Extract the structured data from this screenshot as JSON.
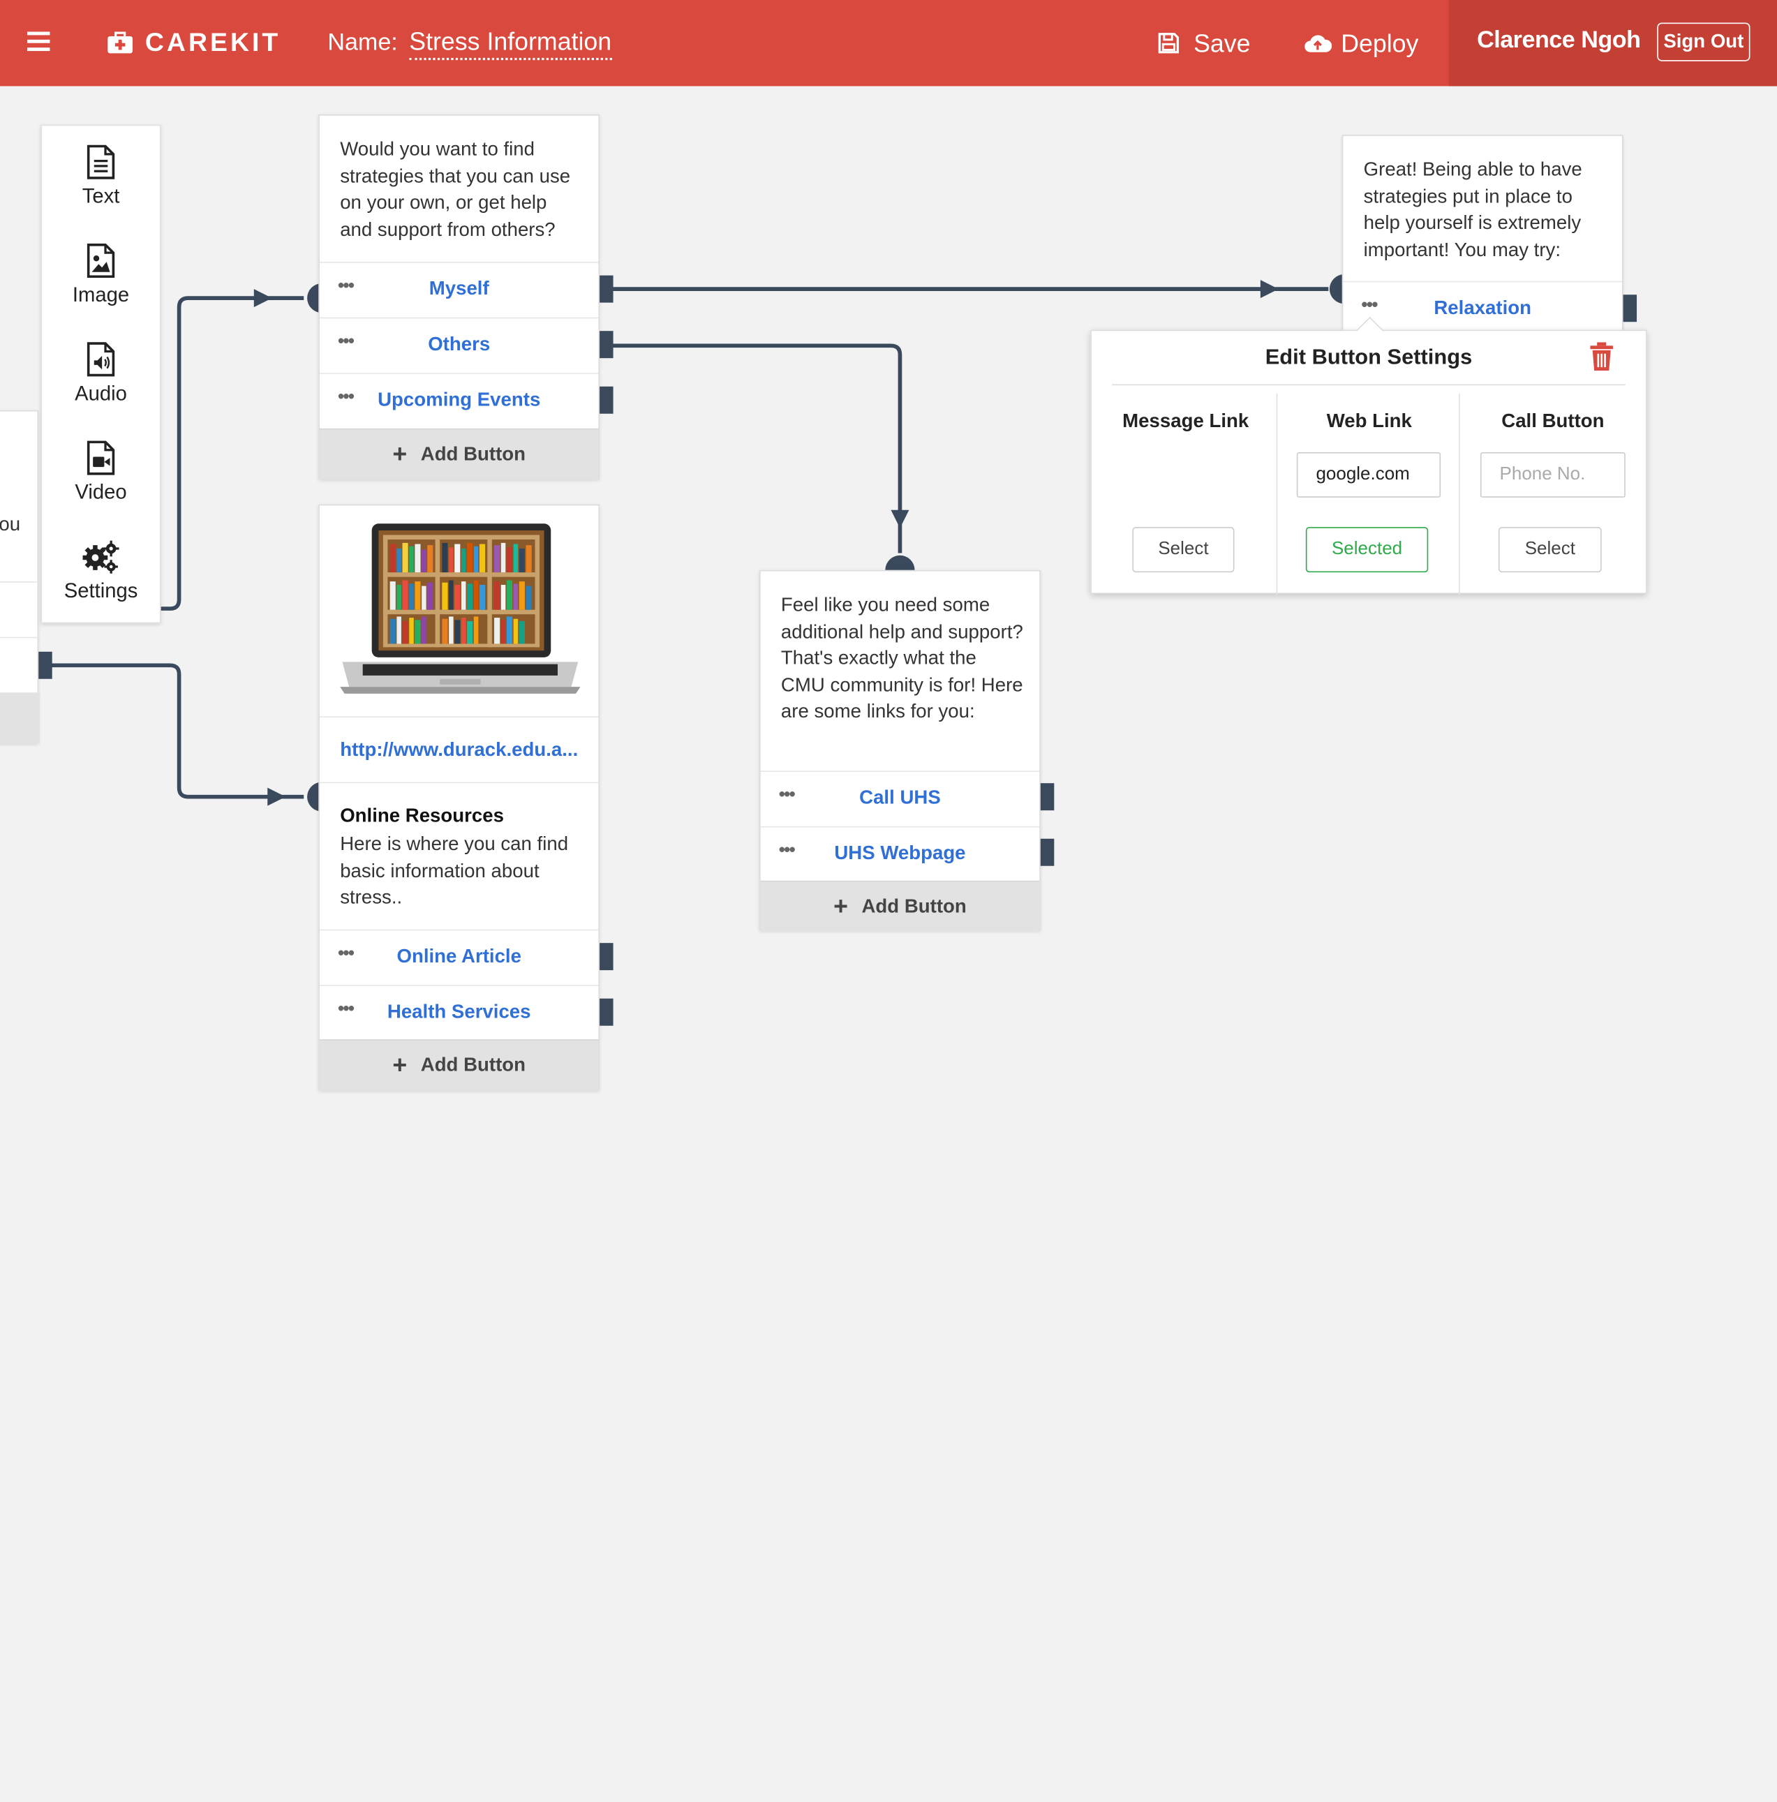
{
  "header": {
    "brand": "CAREKIT",
    "name_label": "Name:",
    "name_value": "Stress Information",
    "save_label": "Save",
    "deploy_label": "Deploy",
    "user_name": "Clarence Ngoh",
    "signout_label": "Sign Out"
  },
  "palette": [
    {
      "label": "Text",
      "icon": "text-doc-icon"
    },
    {
      "label": "Image",
      "icon": "image-doc-icon"
    },
    {
      "label": "Audio",
      "icon": "audio-doc-icon"
    },
    {
      "label": "Video",
      "icon": "video-doc-icon"
    },
    {
      "label": "Settings",
      "icon": "gears-icon"
    }
  ],
  "left_card": {
    "text": "ou"
  },
  "card_question": {
    "text": "Would you want to find strategies that you can use on your own, or get help and support from others?",
    "buttons": [
      "Myself",
      "Others",
      "Upcoming Events"
    ],
    "add_label": "Add Button"
  },
  "card_resources": {
    "link": "http://www.durack.edu.a...",
    "title": "Online Resources",
    "text": "Here is where you can find basic information about stress..",
    "buttons": [
      "Online Article",
      "Health Services"
    ],
    "add_label": "Add Button"
  },
  "card_support": {
    "text": "Feel like you need some additional help and support? That's exactly what the CMU community is for! Here are some links for you:",
    "buttons": [
      "Call UHS",
      "UHS Webpage"
    ],
    "add_label": "Add Button"
  },
  "card_great": {
    "text": "Great! Being able to have strategies put in place to help yourself is extremely important! You may try:",
    "buttons": [
      "Relaxation"
    ]
  },
  "popup": {
    "title": "Edit Button Settings",
    "message_link": "Message Link",
    "web_link": "Web Link",
    "call_button": "Call Button",
    "web_value": "google.com",
    "phone_placeholder": "Phone No.",
    "select_label": "Select",
    "selected_label": "Selected"
  },
  "colors": {
    "header": "#d9493d",
    "header_user": "#c43f34",
    "link": "#2f6fd6",
    "connector": "#3a4a5c",
    "selected": "#2eaa4a",
    "delete": "#d9493d"
  }
}
